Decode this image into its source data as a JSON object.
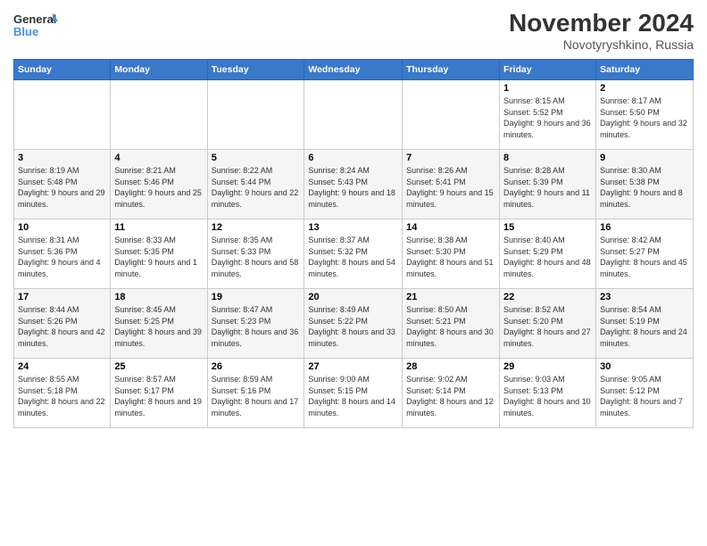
{
  "header": {
    "logo_line1": "General",
    "logo_line2": "Blue",
    "month_title": "November 2024",
    "location": "Novotyryshkino, Russia"
  },
  "weekdays": [
    "Sunday",
    "Monday",
    "Tuesday",
    "Wednesday",
    "Thursday",
    "Friday",
    "Saturday"
  ],
  "weeks": [
    [
      {
        "day": "",
        "info": ""
      },
      {
        "day": "",
        "info": ""
      },
      {
        "day": "",
        "info": ""
      },
      {
        "day": "",
        "info": ""
      },
      {
        "day": "",
        "info": ""
      },
      {
        "day": "1",
        "info": "Sunrise: 8:15 AM\nSunset: 5:52 PM\nDaylight: 9 hours and 36 minutes."
      },
      {
        "day": "2",
        "info": "Sunrise: 8:17 AM\nSunset: 5:50 PM\nDaylight: 9 hours and 32 minutes."
      }
    ],
    [
      {
        "day": "3",
        "info": "Sunrise: 8:19 AM\nSunset: 5:48 PM\nDaylight: 9 hours and 29 minutes."
      },
      {
        "day": "4",
        "info": "Sunrise: 8:21 AM\nSunset: 5:46 PM\nDaylight: 9 hours and 25 minutes."
      },
      {
        "day": "5",
        "info": "Sunrise: 8:22 AM\nSunset: 5:44 PM\nDaylight: 9 hours and 22 minutes."
      },
      {
        "day": "6",
        "info": "Sunrise: 8:24 AM\nSunset: 5:43 PM\nDaylight: 9 hours and 18 minutes."
      },
      {
        "day": "7",
        "info": "Sunrise: 8:26 AM\nSunset: 5:41 PM\nDaylight: 9 hours and 15 minutes."
      },
      {
        "day": "8",
        "info": "Sunrise: 8:28 AM\nSunset: 5:39 PM\nDaylight: 9 hours and 11 minutes."
      },
      {
        "day": "9",
        "info": "Sunrise: 8:30 AM\nSunset: 5:38 PM\nDaylight: 9 hours and 8 minutes."
      }
    ],
    [
      {
        "day": "10",
        "info": "Sunrise: 8:31 AM\nSunset: 5:36 PM\nDaylight: 9 hours and 4 minutes."
      },
      {
        "day": "11",
        "info": "Sunrise: 8:33 AM\nSunset: 5:35 PM\nDaylight: 9 hours and 1 minute."
      },
      {
        "day": "12",
        "info": "Sunrise: 8:35 AM\nSunset: 5:33 PM\nDaylight: 8 hours and 58 minutes."
      },
      {
        "day": "13",
        "info": "Sunrise: 8:37 AM\nSunset: 5:32 PM\nDaylight: 8 hours and 54 minutes."
      },
      {
        "day": "14",
        "info": "Sunrise: 8:38 AM\nSunset: 5:30 PM\nDaylight: 8 hours and 51 minutes."
      },
      {
        "day": "15",
        "info": "Sunrise: 8:40 AM\nSunset: 5:29 PM\nDaylight: 8 hours and 48 minutes."
      },
      {
        "day": "16",
        "info": "Sunrise: 8:42 AM\nSunset: 5:27 PM\nDaylight: 8 hours and 45 minutes."
      }
    ],
    [
      {
        "day": "17",
        "info": "Sunrise: 8:44 AM\nSunset: 5:26 PM\nDaylight: 8 hours and 42 minutes."
      },
      {
        "day": "18",
        "info": "Sunrise: 8:45 AM\nSunset: 5:25 PM\nDaylight: 8 hours and 39 minutes."
      },
      {
        "day": "19",
        "info": "Sunrise: 8:47 AM\nSunset: 5:23 PM\nDaylight: 8 hours and 36 minutes."
      },
      {
        "day": "20",
        "info": "Sunrise: 8:49 AM\nSunset: 5:22 PM\nDaylight: 8 hours and 33 minutes."
      },
      {
        "day": "21",
        "info": "Sunrise: 8:50 AM\nSunset: 5:21 PM\nDaylight: 8 hours and 30 minutes."
      },
      {
        "day": "22",
        "info": "Sunrise: 8:52 AM\nSunset: 5:20 PM\nDaylight: 8 hours and 27 minutes."
      },
      {
        "day": "23",
        "info": "Sunrise: 8:54 AM\nSunset: 5:19 PM\nDaylight: 8 hours and 24 minutes."
      }
    ],
    [
      {
        "day": "24",
        "info": "Sunrise: 8:55 AM\nSunset: 5:18 PM\nDaylight: 8 hours and 22 minutes."
      },
      {
        "day": "25",
        "info": "Sunrise: 8:57 AM\nSunset: 5:17 PM\nDaylight: 8 hours and 19 minutes."
      },
      {
        "day": "26",
        "info": "Sunrise: 8:59 AM\nSunset: 5:16 PM\nDaylight: 8 hours and 17 minutes."
      },
      {
        "day": "27",
        "info": "Sunrise: 9:00 AM\nSunset: 5:15 PM\nDaylight: 8 hours and 14 minutes."
      },
      {
        "day": "28",
        "info": "Sunrise: 9:02 AM\nSunset: 5:14 PM\nDaylight: 8 hours and 12 minutes."
      },
      {
        "day": "29",
        "info": "Sunrise: 9:03 AM\nSunset: 5:13 PM\nDaylight: 8 hours and 10 minutes."
      },
      {
        "day": "30",
        "info": "Sunrise: 9:05 AM\nSunset: 5:12 PM\nDaylight: 8 hours and 7 minutes."
      }
    ]
  ]
}
